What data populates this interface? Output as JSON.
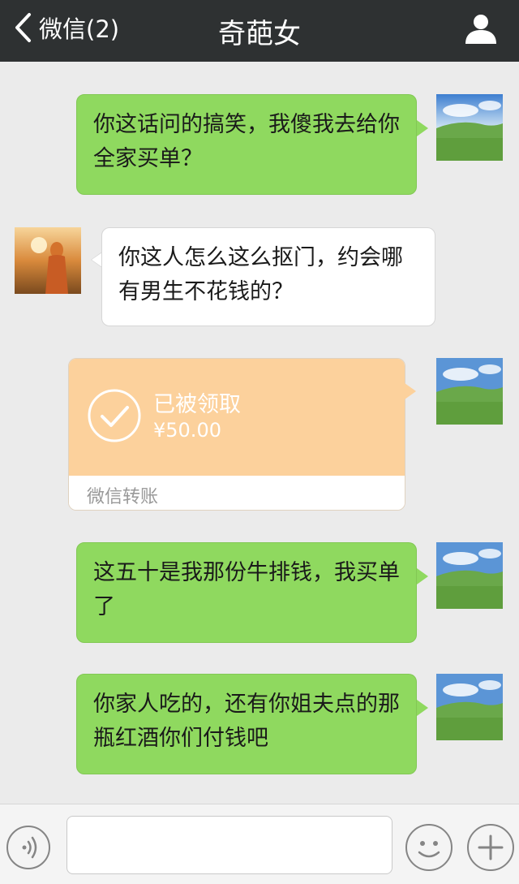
{
  "header": {
    "back_label": "微信(2)",
    "title": "奇葩女"
  },
  "messages": [
    {
      "side": "right",
      "text": "你这话问的搞笑，我傻我去给你全家买单？"
    },
    {
      "side": "left",
      "text": "你这人怎么这么抠门，约会哪有男生不花钱的？"
    },
    {
      "side": "right",
      "type": "transfer",
      "status": "已被领取",
      "amount": "¥50.00",
      "label": "微信转账"
    },
    {
      "side": "right",
      "text": "这五十是我那份牛排钱，我买单了"
    },
    {
      "side": "right",
      "text": "你家人吃的，还有你姐夫点的那瓶红酒你们付钱吧"
    }
  ],
  "colors": {
    "header_bg": "#2e3132",
    "chat_bg": "#ebebeb",
    "sent_bubble": "#8fd95f",
    "received_bubble": "#ffffff",
    "transfer_bg": "#fcd19c"
  }
}
